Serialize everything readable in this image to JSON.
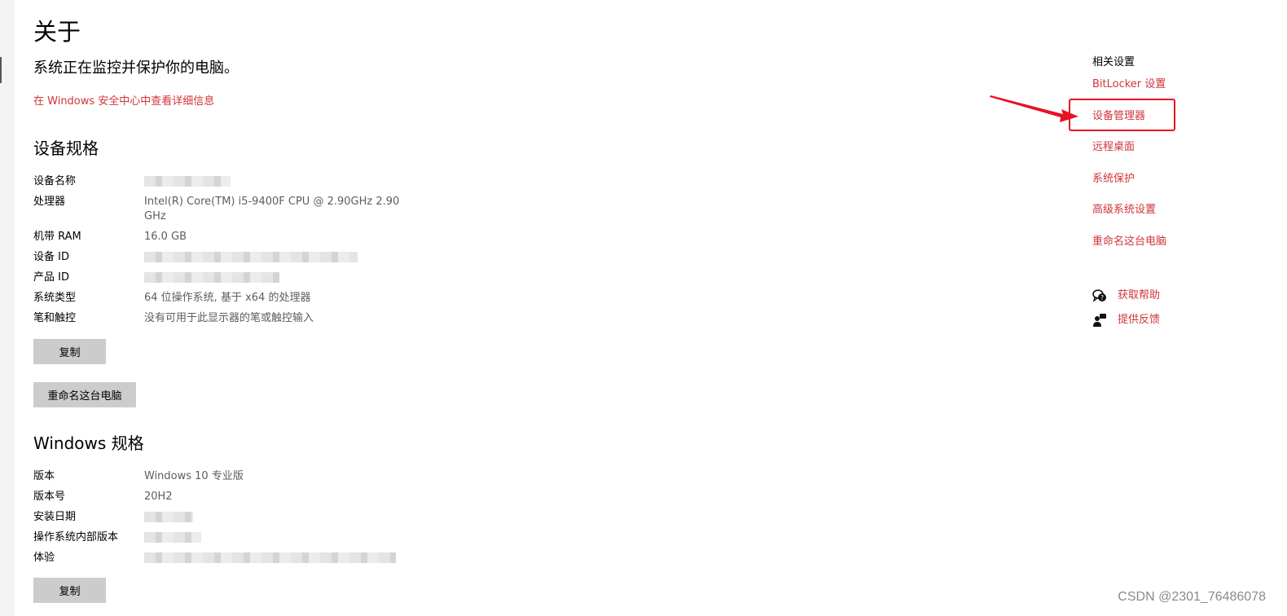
{
  "page": {
    "title": "关于",
    "protection_status": "系统正在监控并保护你的电脑。",
    "security_link": "在 Windows 安全中心中查看详细信息"
  },
  "device_specs": {
    "heading": "设备规格",
    "rows": [
      {
        "label": "设备名称",
        "value": ""
      },
      {
        "label": "处理器",
        "value": "Intel(R) Core(TM) i5-9400F CPU @ 2.90GHz   2.90 GHz"
      },
      {
        "label": "机带 RAM",
        "value": "16.0 GB"
      },
      {
        "label": "设备 ID",
        "value": ""
      },
      {
        "label": "产品 ID",
        "value": ""
      },
      {
        "label": "系统类型",
        "value": "64 位操作系统, 基于 x64 的处理器"
      },
      {
        "label": "笔和触控",
        "value": "没有可用于此显示器的笔或触控输入"
      }
    ],
    "copy_button": "复制",
    "rename_button": "重命名这台电脑"
  },
  "windows_specs": {
    "heading": "Windows 规格",
    "rows": [
      {
        "label": "版本",
        "value": "Windows 10 专业版"
      },
      {
        "label": "版本号",
        "value": "20H2"
      },
      {
        "label": "安装日期",
        "value": ""
      },
      {
        "label": "操作系统内部版本",
        "value": ""
      },
      {
        "label": "体验",
        "value": ""
      }
    ],
    "copy_button": "复制"
  },
  "related": {
    "heading": "相关设置",
    "links": [
      "BitLocker 设置",
      "设备管理器",
      "远程桌面",
      "系统保护",
      "高级系统设置",
      "重命名这台电脑"
    ]
  },
  "help": {
    "get_help": "获取帮助",
    "feedback": "提供反馈",
    "get_help_icon": "chat-help-icon",
    "feedback_icon": "feedback-person-icon"
  },
  "watermark": "CSDN @2301_76486078",
  "colors": {
    "accent": "#d13438",
    "annotation": "#e81123",
    "button_bg": "#cccccc"
  }
}
